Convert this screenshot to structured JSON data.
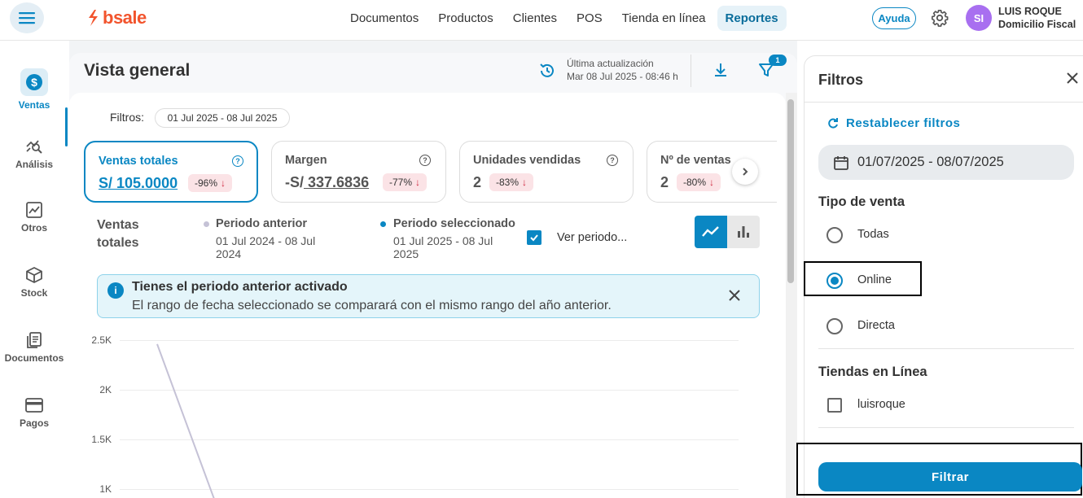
{
  "brand": {
    "name": "bsale",
    "color": "#f2542d"
  },
  "accent": "#0a87c3",
  "topnav": {
    "items": [
      "Documentos",
      "Productos",
      "Clientes",
      "POS",
      "Tienda en línea",
      "Reportes"
    ],
    "active": "Reportes",
    "help_label": "Ayuda",
    "avatar_initials": "SI",
    "user_name": "LUIS ROQUE",
    "user_branch": "Domicilio Fiscal"
  },
  "sidebar": {
    "items": [
      {
        "label": "Ventas",
        "icon": "dollar-icon",
        "active": true
      },
      {
        "label": "Análisis",
        "icon": "analytics-icon"
      },
      {
        "label": "Otros",
        "icon": "trend-chart-icon"
      },
      {
        "label": "Stock",
        "icon": "box-icon"
      },
      {
        "label": "Documentos",
        "icon": "documents-icon"
      },
      {
        "label": "Pagos",
        "icon": "card-icon"
      }
    ]
  },
  "main": {
    "title": "Vista general",
    "update_label": "Última actualización",
    "update_date": "Mar 08 Jul 2025 - 08:46 h",
    "filter_badge": "1",
    "filters_label": "Filtros:",
    "filters_chip": "01 Jul 2025 - 08 Jul 2025"
  },
  "kpis": [
    {
      "title": "Ventas totales",
      "value": "S/ 105.0000",
      "change": "-96%",
      "active": true
    },
    {
      "title": "Margen",
      "value_prefix": "-S/",
      "value": " 337.6836",
      "change": "-77%"
    },
    {
      "title": "Unidades vendidas",
      "value": "2",
      "change": "-83%"
    },
    {
      "title": "Nº de ventas",
      "value": "2",
      "change": "-80%"
    }
  ],
  "series_header": {
    "title_line1": "Ventas",
    "title_line2": "totales",
    "prev_title": "Periodo anterior",
    "prev_range_1": "01 Jul 2024 - 08 Jul",
    "prev_range_2": "2024",
    "sel_title": "Periodo seleccionado",
    "sel_range_1": "01 Jul 2025 - 08 Jul",
    "sel_range_2": "2025",
    "compare_label": "Ver periodo...",
    "prev_color": "#c5c2d6",
    "sel_color": "#0a87c3"
  },
  "alert": {
    "title": "Tienes el periodo anterior activado",
    "message": "El rango de fecha seleccionado se comparará con el mismo rango del año anterior."
  },
  "chart_data": {
    "type": "line",
    "y_ticks": [
      "2.5K",
      "2K",
      "1.5K",
      "1K"
    ],
    "ylim": [
      1000,
      2500
    ],
    "series": [
      {
        "values": [
          2460,
          900
        ],
        "color": "#c5c2d6"
      }
    ]
  },
  "filter_panel": {
    "title": "Filtros",
    "reset_label": "Restablecer filtros",
    "date_range": "01/07/2025 - 08/07/2025",
    "sale_type_title": "Tipo de venta",
    "sale_types": [
      "Todas",
      "Online",
      "Directa"
    ],
    "selected_sale_type": "Online",
    "stores_title": "Tiendas en Línea",
    "stores": [
      "luisroque"
    ],
    "submit_label": "Filtrar"
  }
}
